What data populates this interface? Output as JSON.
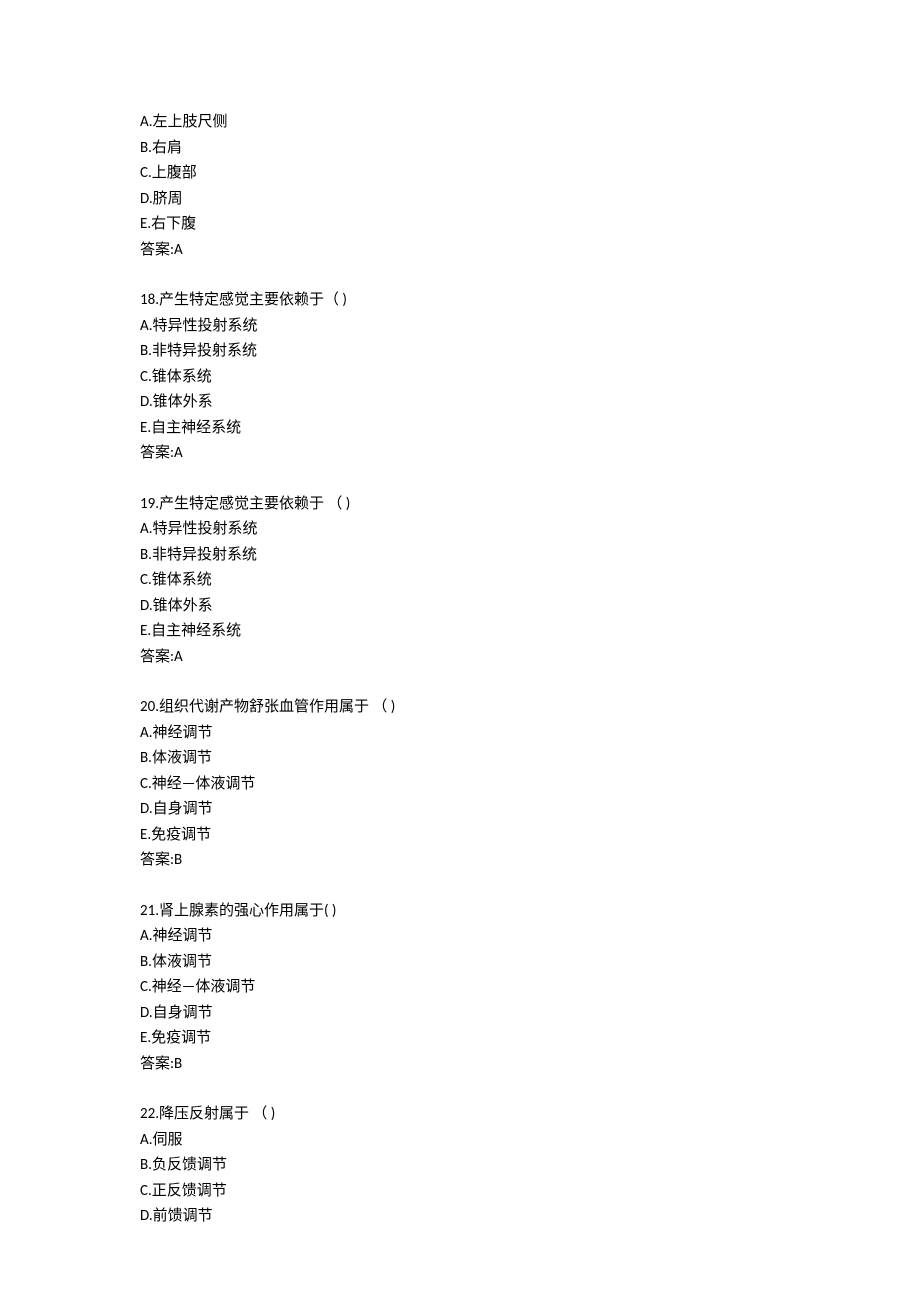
{
  "blocks": [
    {
      "lines": [
        "A.左上肢尺侧",
        "B.右肩",
        "C.上腹部",
        "D.脐周",
        "E.右下腹",
        "答案:A"
      ]
    },
    {
      "lines": [
        "18.产生特定感觉主要依赖于（ )",
        "A.特异性投射系统",
        "B.非特异投射系统",
        "C.锥体系统",
        "D.锥体外系",
        "E.自主神经系统",
        "答案:A"
      ]
    },
    {
      "lines": [
        "19.产生特定感觉主要依赖于 （ )",
        "A.特异性投射系统",
        "B.非特异投射系统",
        "C.锥体系统",
        "D.锥体外系",
        "E.自主神经系统",
        "答案:A"
      ]
    },
    {
      "lines": [
        "20.组织代谢产物舒张血管作用属于 （ )",
        "A.神经调节",
        "B.体液调节",
        "C.神经—体液调节",
        "D.自身调节",
        "E.免疫调节",
        "答案:B"
      ]
    },
    {
      "lines": [
        "21.肾上腺素的强心作用属于( )",
        "A.神经调节",
        "B.体液调节",
        "C.神经—体液调节",
        "D.自身调节",
        "E.免疫调节",
        "答案:B"
      ]
    },
    {
      "lines": [
        "22.降压反射属于 （ )",
        "A.伺服",
        "B.负反馈调节",
        "C.正反馈调节",
        "D.前馈调节"
      ]
    }
  ]
}
